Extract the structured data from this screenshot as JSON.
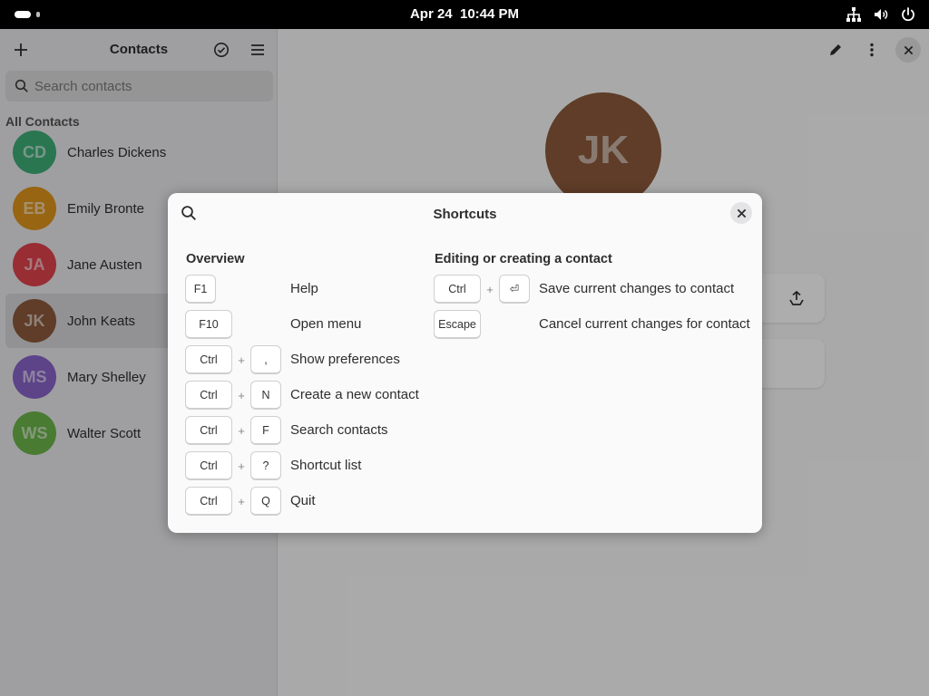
{
  "topbar": {
    "date": "Apr 24",
    "time": "10:44 PM"
  },
  "sidebar": {
    "title": "Contacts",
    "search_placeholder": "Search contacts",
    "group_label": "All Contacts",
    "contacts": [
      {
        "initials": "CD",
        "name": "Charles Dickens",
        "color": "#3eae78"
      },
      {
        "initials": "EB",
        "name": "Emily Bronte",
        "color": "#e0961c"
      },
      {
        "initials": "JA",
        "name": "Jane Austen",
        "color": "#e0434d"
      },
      {
        "initials": "JK",
        "name": "John Keats",
        "color": "#8c5a3c"
      },
      {
        "initials": "MS",
        "name": "Mary Shelley",
        "color": "#8a63c9"
      },
      {
        "initials": "WS",
        "name": "Walter Scott",
        "color": "#6cb54a"
      }
    ],
    "selected_index": 3
  },
  "details": {
    "initials": "JK",
    "color": "#8c5a3c"
  },
  "dialog": {
    "title": "Shortcuts",
    "sections": [
      {
        "title": "Overview",
        "shortcuts": [
          {
            "keys": [
              "F1"
            ],
            "label": "Help"
          },
          {
            "keys": [
              "F10"
            ],
            "label": "Open menu"
          },
          {
            "keys": [
              "Ctrl",
              ","
            ],
            "label": "Show preferences"
          },
          {
            "keys": [
              "Ctrl",
              "N"
            ],
            "label": "Create a new contact"
          },
          {
            "keys": [
              "Ctrl",
              "F"
            ],
            "label": "Search contacts"
          },
          {
            "keys": [
              "Ctrl",
              "?"
            ],
            "label": "Shortcut list"
          },
          {
            "keys": [
              "Ctrl",
              "Q"
            ],
            "label": "Quit"
          }
        ]
      },
      {
        "title": "Editing or creating a contact",
        "shortcuts": [
          {
            "keys": [
              "Ctrl",
              "⏎"
            ],
            "label": "Save current changes to contact"
          },
          {
            "keys": [
              "Escape"
            ],
            "label": "Cancel current changes for contact"
          }
        ]
      }
    ],
    "plus": "+"
  }
}
